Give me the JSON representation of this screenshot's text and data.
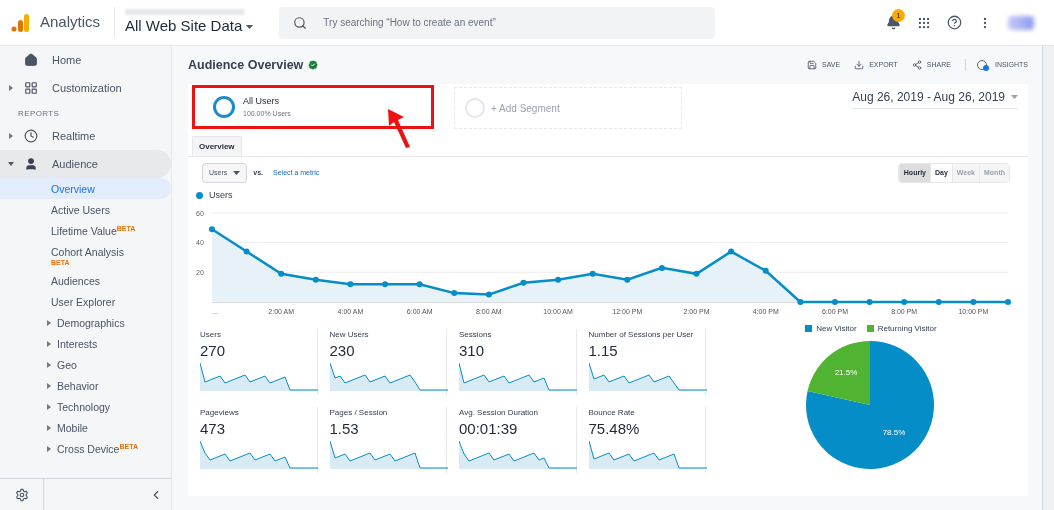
{
  "header": {
    "product": "Analytics",
    "view": "All Web Site Data",
    "search": {
      "placeholder": "Try searching “How to create an event”"
    },
    "notifications": "1"
  },
  "sidebar": {
    "items": [
      {
        "label": "Home",
        "kind": "page"
      },
      {
        "label": "Customization",
        "kind": "group"
      }
    ],
    "section": "REPORTS",
    "reports": [
      {
        "label": "Realtime",
        "expanded": false,
        "selected": false
      },
      {
        "label": "Audience",
        "expanded": true,
        "selected": true,
        "children": [
          {
            "label": "Overview",
            "selected": true,
            "kind": "page"
          },
          {
            "label": "Active Users",
            "selected": false,
            "kind": "page"
          },
          {
            "label": "Lifetime Value",
            "badge": "BETA",
            "selected": false,
            "kind": "page"
          },
          {
            "label": "Cohort Analysis",
            "badge": "BETA",
            "selected": false,
            "kind": "stacked"
          },
          {
            "label": "Audiences",
            "selected": false,
            "kind": "page"
          },
          {
            "label": "User Explorer",
            "selected": false,
            "kind": "page"
          },
          {
            "label": "Demographics",
            "selected": false,
            "kind": "group"
          },
          {
            "label": "Interests",
            "selected": false,
            "kind": "group"
          },
          {
            "label": "Geo",
            "selected": false,
            "kind": "group"
          },
          {
            "label": "Behavior",
            "selected": false,
            "kind": "group"
          },
          {
            "label": "Technology",
            "selected": false,
            "kind": "group"
          },
          {
            "label": "Mobile",
            "selected": false,
            "kind": "group"
          },
          {
            "label": "Cross Device",
            "badge": "BETA",
            "selected": false,
            "kind": "group"
          }
        ]
      }
    ]
  },
  "page": {
    "title": "Audience Overview",
    "actions": [
      "SAVE",
      "EXPORT",
      "SHARE",
      "INSIGHTS"
    ],
    "segments": [
      {
        "title": "All Users",
        "subtitle": "100.00% Users",
        "kind": "active"
      },
      {
        "title": "+ Add Segment",
        "kind": "add"
      }
    ],
    "date_range": "Aug 26, 2019 - Aug 26, 2019",
    "tabs": [
      {
        "label": "Overview",
        "selected": true
      }
    ],
    "metric": "Users",
    "vs": "vs.",
    "select_metric": "Select a metric",
    "granularity": [
      {
        "label": "Hourly",
        "selected": true,
        "disabled": false
      },
      {
        "label": "Day",
        "selected": false,
        "disabled": false
      },
      {
        "label": "Week",
        "selected": false,
        "disabled": true
      },
      {
        "label": "Month",
        "selected": false,
        "disabled": true
      }
    ],
    "line_chart": {
      "chart_data": {
        "type": "area",
        "x": [
          0,
          1,
          2,
          3,
          4,
          5,
          6,
          7,
          8,
          9,
          10,
          11,
          12,
          13,
          14,
          15,
          16,
          17,
          18,
          19,
          20,
          21,
          22,
          23
        ],
        "series": [
          {
            "name": "Users",
            "color": "#058dc7",
            "values": [
              49,
              34,
              19,
              15,
              12,
              12,
              12,
              6,
              5,
              13,
              15,
              19,
              15,
              23,
              19,
              34,
              21,
              0,
              0,
              0,
              0,
              0,
              0,
              0
            ]
          }
        ],
        "xlim": [
          0,
          23
        ],
        "ylim": [
          0,
          60
        ],
        "yticks": [
          20,
          40,
          60
        ],
        "xticks": [
          {
            "value": 0,
            "label": "..."
          },
          {
            "value": 2,
            "label": "2:00 AM"
          },
          {
            "value": 4,
            "label": "4:00 AM"
          },
          {
            "value": 6,
            "label": "6:00 AM"
          },
          {
            "value": 8,
            "label": "8:00 AM"
          },
          {
            "value": 10,
            "label": "10:00 AM"
          },
          {
            "value": 12,
            "label": "12:00 PM"
          },
          {
            "value": 14,
            "label": "2:00 PM"
          },
          {
            "value": 16,
            "label": "4:00 PM"
          },
          {
            "value": 18,
            "label": "6:00 PM"
          },
          {
            "value": 20,
            "label": "8:00 PM"
          },
          {
            "value": 22,
            "label": "10:00 PM"
          }
        ]
      }
    },
    "metrics": [
      {
        "label": "Users",
        "value": "270"
      },
      {
        "label": "New Users",
        "value": "230"
      },
      {
        "label": "Sessions",
        "value": "310"
      },
      {
        "label": "Number of Sessions per User",
        "value": "1.15"
      },
      {
        "label": "Pageviews",
        "value": "473"
      },
      {
        "label": "Pages / Session",
        "value": "1.53"
      },
      {
        "label": "Avg. Session Duration",
        "value": "00:01:39"
      },
      {
        "label": "Bounce Rate",
        "value": "75.48%"
      }
    ],
    "pie_chart": {
      "slices": [
        {
          "color": "#058dc7"
        },
        {
          "color": "#50b432"
        }
      ],
      "chart_data": {
        "type": "pie",
        "legend": "top",
        "categories": [
          "New Visitor",
          "Returning Visitor"
        ],
        "series": [
          {
            "values": [
              78.5,
              21.5
            ]
          }
        ],
        "value_labels": [
          "78.5%",
          "21.5%"
        ]
      }
    }
  }
}
